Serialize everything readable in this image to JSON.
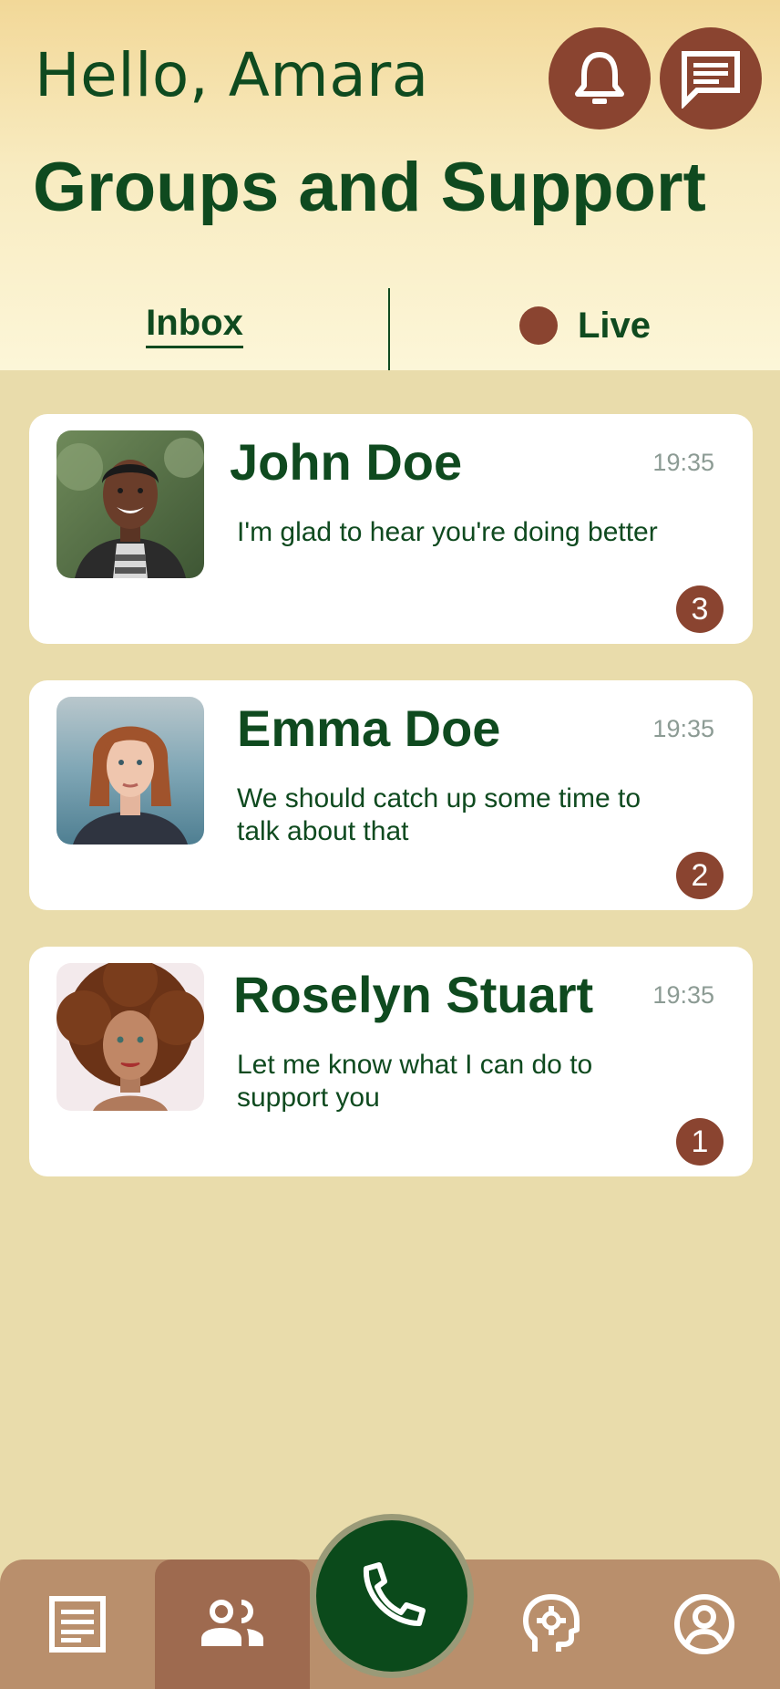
{
  "header": {
    "greeting": "Hello, Amara",
    "title": "Groups and Support",
    "notifications_icon": "bell-icon",
    "messages_icon": "chat-icon"
  },
  "tabs": {
    "inbox_label": "Inbox",
    "live_label": "Live"
  },
  "conversations": [
    {
      "name": "John Doe",
      "time": "19:35",
      "preview": "I'm glad to hear you're doing better",
      "unread": "3"
    },
    {
      "name": "Emma Doe",
      "time": "19:35",
      "preview": "We should catch up some time to talk about that",
      "unread": "2"
    },
    {
      "name": "Roselyn Stuart",
      "time": "19:35",
      "preview": "Let me know what I can do to support you",
      "unread": "1"
    }
  ],
  "bottom_nav": {
    "items": [
      "journal-icon",
      "groups-icon",
      "phone-icon",
      "mind-icon",
      "profile-icon"
    ],
    "active": "groups-icon"
  },
  "colors": {
    "primary_green": "#0f4a1f",
    "accent_brown": "#8a4430",
    "background": "#e9dcab",
    "nav_background": "#b98f6c",
    "nav_active": "#9e6a4f"
  }
}
